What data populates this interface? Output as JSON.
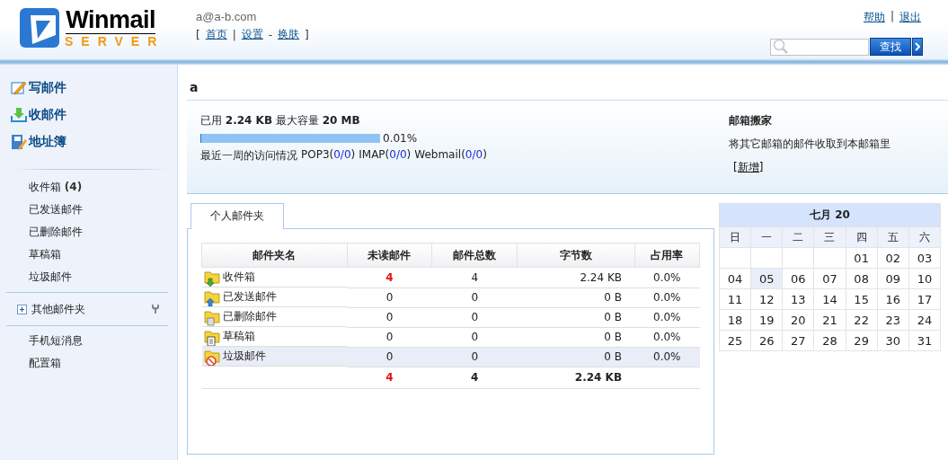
{
  "header": {
    "logo": {
      "name": "Winmail",
      "sub": "SERVER"
    },
    "account": "a@a-b.com",
    "nav": [
      {
        "label": "首页",
        "sep": "|"
      },
      {
        "label": "设置",
        "sep": "-"
      },
      {
        "label": "换肤"
      }
    ],
    "nav_open": "[",
    "nav_close": "]",
    "links": [
      {
        "label": "帮助"
      },
      {
        "label": "退出"
      }
    ],
    "link_sep": "|",
    "search": {
      "button": "查找"
    }
  },
  "sidebar": {
    "actions": [
      {
        "kind": "compose",
        "label": "写邮件"
      },
      {
        "kind": "receive",
        "label": "收邮件"
      },
      {
        "kind": "contacts",
        "label": "地址簿"
      }
    ],
    "folders": [
      {
        "label": "收件箱 **(4)**"
      },
      {
        "label": "已发送邮件"
      },
      {
        "label": "已删除邮件"
      },
      {
        "label": "草稿箱"
      },
      {
        "label": "垃圾邮件"
      }
    ],
    "group": {
      "label": "其他邮件夹",
      "expanded": false
    },
    "extras": [
      {
        "label": "手机短消息"
      },
      {
        "label": "配置箱"
      }
    ]
  },
  "main": {
    "title": "a",
    "usage": {
      "text": "已用  **2.24 KB** 最大容量  **20 MB**",
      "level": 0.0001,
      "reading": "0.01%",
      "access_label": "最近一周的访问情况",
      "access": [
        {
          "before": "POP3(",
          "value": "0/0",
          "after": ")"
        },
        {
          "before": "IMAP(",
          "value": "0/0",
          "after": ")"
        },
        {
          "before": "Webmail(",
          "value": "0/0",
          "after": ")"
        }
      ]
    },
    "move": {
      "title": "邮箱搬家",
      "text": "将其它邮箱的邮件收取到本邮箱里",
      "link": "[新增]"
    },
    "tabs": [
      {
        "label": "个人邮件夹",
        "selected": true
      }
    ],
    "table": {
      "columns": [
        "邮件夹名",
        "未读邮件",
        "邮件总数",
        "字节数",
        "占用率"
      ],
      "rows": [
        {
          "kind": "inbox",
          "name": "收件箱",
          "unread": "4",
          "total": "4",
          "bytes": "2.24 KB",
          "usage": "0.0%",
          "selected": false
        },
        {
          "kind": "sent",
          "name": "已发送邮件",
          "unread": "0",
          "total": "0",
          "bytes": "0 B",
          "usage": "0.0%",
          "selected": false
        },
        {
          "kind": "deleted",
          "name": "已删除邮件",
          "unread": "0",
          "total": "0",
          "bytes": "0 B",
          "usage": "0.0%",
          "selected": false
        },
        {
          "kind": "drafts",
          "name": "草稿箱",
          "unread": "0",
          "total": "0",
          "bytes": "0 B",
          "usage": "0.0%",
          "selected": false
        },
        {
          "kind": "junk",
          "name": "垃圾邮件",
          "unread": "0",
          "total": "0",
          "bytes": "0 B",
          "usage": "0.0%",
          "selected": true
        }
      ],
      "totals": {
        "unread": "4",
        "total": "4",
        "bytes": "2.24 KB"
      }
    }
  },
  "calendar": {
    "month": "七月 20",
    "weekdays": [
      "日",
      "一",
      "二",
      "三",
      "四",
      "五",
      "六"
    ],
    "weeks": [
      [
        {
          "day": "01",
          "selected": false
        },
        {
          "day": "02",
          "selected": false
        },
        {
          "day": "03",
          "selected": false
        }
      ],
      [
        {
          "day": "04",
          "selected": false
        },
        {
          "day": "05",
          "selected": true
        },
        {
          "day": "06",
          "selected": false
        },
        {
          "day": "07",
          "selected": false
        },
        {
          "day": "08",
          "selected": false
        },
        {
          "day": "09",
          "selected": false
        },
        {
          "day": "10",
          "selected": false
        }
      ],
      [
        {
          "day": "11",
          "selected": false
        },
        {
          "day": "12",
          "selected": false
        },
        {
          "day": "13",
          "selected": false
        },
        {
          "day": "14",
          "selected": false
        },
        {
          "day": "15",
          "selected": false
        },
        {
          "day": "16",
          "selected": false
        },
        {
          "day": "17",
          "selected": false
        }
      ],
      [
        {
          "day": "18",
          "selected": false
        },
        {
          "day": "19",
          "selected": false
        },
        {
          "day": "20",
          "selected": false
        },
        {
          "day": "21",
          "selected": false
        },
        {
          "day": "22",
          "selected": false
        },
        {
          "day": "23",
          "selected": false
        },
        {
          "day": "24",
          "selected": false
        }
      ],
      [
        {
          "day": "25",
          "selected": false
        },
        {
          "day": "26",
          "selected": false
        },
        {
          "day": "27",
          "selected": false
        },
        {
          "day": "28",
          "selected": false
        },
        {
          "day": "29",
          "selected": false
        },
        {
          "day": "30",
          "selected": false
        },
        {
          "day": "31",
          "selected": false
        }
      ]
    ]
  }
}
